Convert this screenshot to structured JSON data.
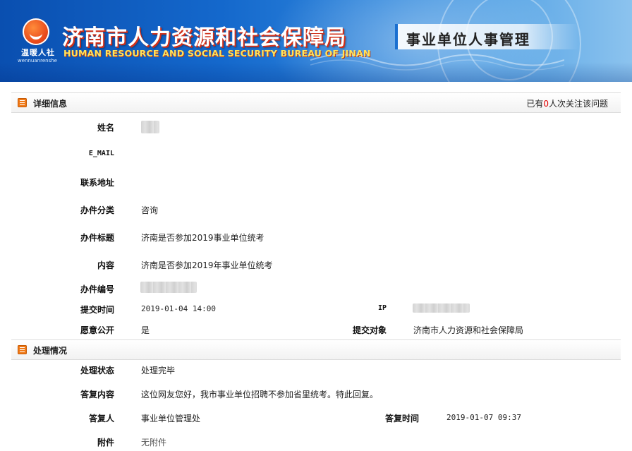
{
  "banner": {
    "logo_text": "温暖人社",
    "logo_sub": "wennuanrenshe",
    "title_cn": "济南市人力资源和社会保障局",
    "title_en": "HUMAN RESOURCE AND SOCIAL SECURITY BUREAU OF JINAN",
    "system_name": "事业单位人事管理"
  },
  "details": {
    "section_title": "详细信息",
    "follow_prefix": "已有",
    "follow_count": "0",
    "follow_suffix": "人次关注该问题",
    "name_label": "姓名",
    "email_label": "E_MAIL",
    "address_label": "联系地址",
    "category_label": "办件分类",
    "category_value": "咨询",
    "subject_label": "办件标题",
    "subject_value": "济南是否参加2019事业单位统考",
    "content_label": "内容",
    "content_value": "济南是否参加2019年事业单位统考",
    "number_label": "办件编号",
    "submit_time_label": "提交时间",
    "submit_time_value": "2019-01-04 14:00",
    "ip_label": "IP",
    "public_label": "愿意公开",
    "public_value": "是",
    "target_label": "提交对象",
    "target_value": "济南市人力资源和社会保障局"
  },
  "processing": {
    "section_title": "处理情况",
    "status_label": "处理状态",
    "status_value": "处理完毕",
    "reply_content_label": "答复内容",
    "reply_content_value": "这位网友您好，我市事业单位招聘不参加省里统考。特此回复。",
    "replier_label": "答复人",
    "replier_value": "事业单位管理处",
    "reply_time_label": "答复时间",
    "reply_time_value": "2019-01-07 09:37",
    "attachment_label": "附件",
    "attachment_value": "无附件"
  }
}
